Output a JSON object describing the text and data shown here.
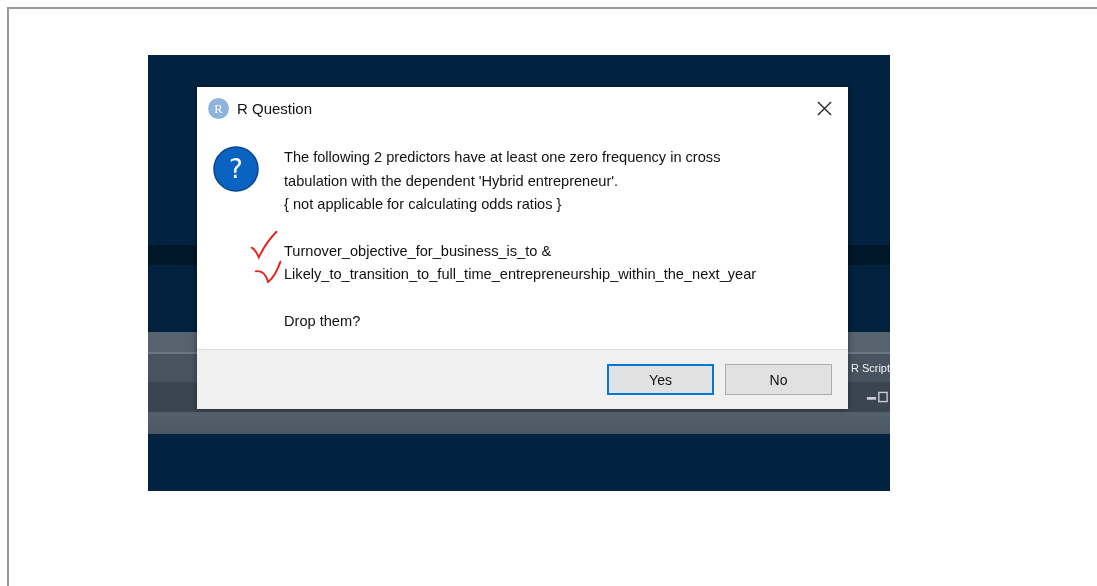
{
  "background_app": {
    "tab_label": "R Script"
  },
  "dialog": {
    "app_icon_glyph": "R",
    "title": "R Question",
    "question_icon_glyph": "?",
    "message_lines": [
      "The following 2 predictors have at least one zero frequency in cross",
      "tabulation with the dependent 'Hybrid entrepreneur'.",
      "{ not applicable for calculating odds ratios }"
    ],
    "predictors": [
      {
        "name": "Turnover_objective_for_business_is_to &",
        "marked": true
      },
      {
        "name": "Likely_to_transition_to_full_time_entrepreneurship_within_the_next_year",
        "marked": true
      }
    ],
    "question": "Drop them?",
    "buttons": [
      {
        "label": "Yes",
        "selected": true
      },
      {
        "label": "No",
        "selected": false
      }
    ]
  }
}
